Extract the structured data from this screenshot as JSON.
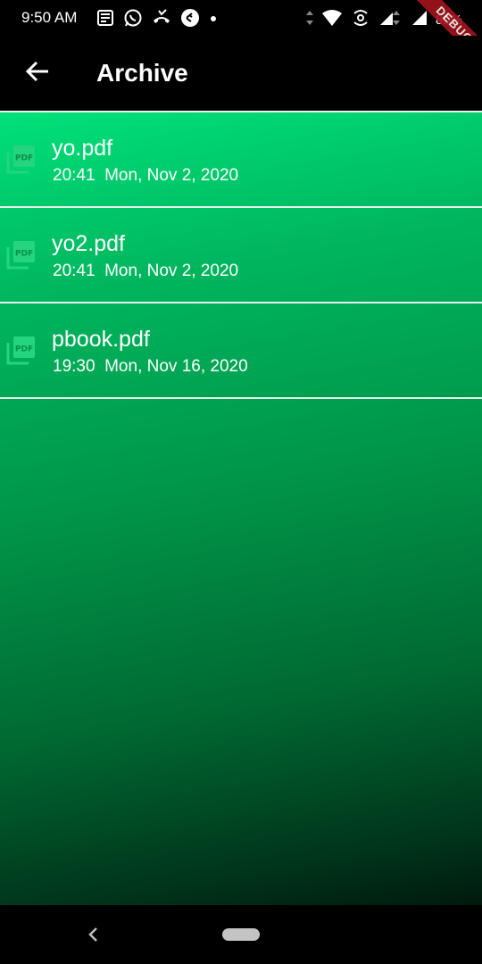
{
  "status_bar": {
    "time": "9:50 AM",
    "battery": "80%",
    "left_icons": [
      "news-icon",
      "whatsapp-icon",
      "missed-call-icon",
      "shazam-icon",
      "dot-icon"
    ],
    "right_icons": [
      "data-arrows-icon",
      "wifi-icon",
      "hotspot-icon",
      "signal-icon",
      "battery-icon"
    ]
  },
  "debug_banner": "DEBUG",
  "app_bar": {
    "title": "Archive",
    "back_icon": "arrow-back-icon"
  },
  "files": [
    {
      "name": "yo.pdf",
      "time": "20:41",
      "date": "Mon, Nov 2, 2020",
      "icon": "pdf-icon"
    },
    {
      "name": "yo2.pdf",
      "time": "20:41",
      "date": "Mon, Nov 2, 2020",
      "icon": "pdf-icon"
    },
    {
      "name": "pbook.pdf",
      "time": "19:30",
      "date": "Mon, Nov 16, 2020",
      "icon": "pdf-icon"
    }
  ],
  "colors": {
    "background_top": "#00e17a",
    "background_bottom": "#001a0d",
    "app_bar": "#000000",
    "text": "#ffffff",
    "debug_ribbon": "#a3141d"
  },
  "nav_bar": {
    "back_icon": "chevron-left-icon",
    "home_icon": "home-pill-icon"
  }
}
